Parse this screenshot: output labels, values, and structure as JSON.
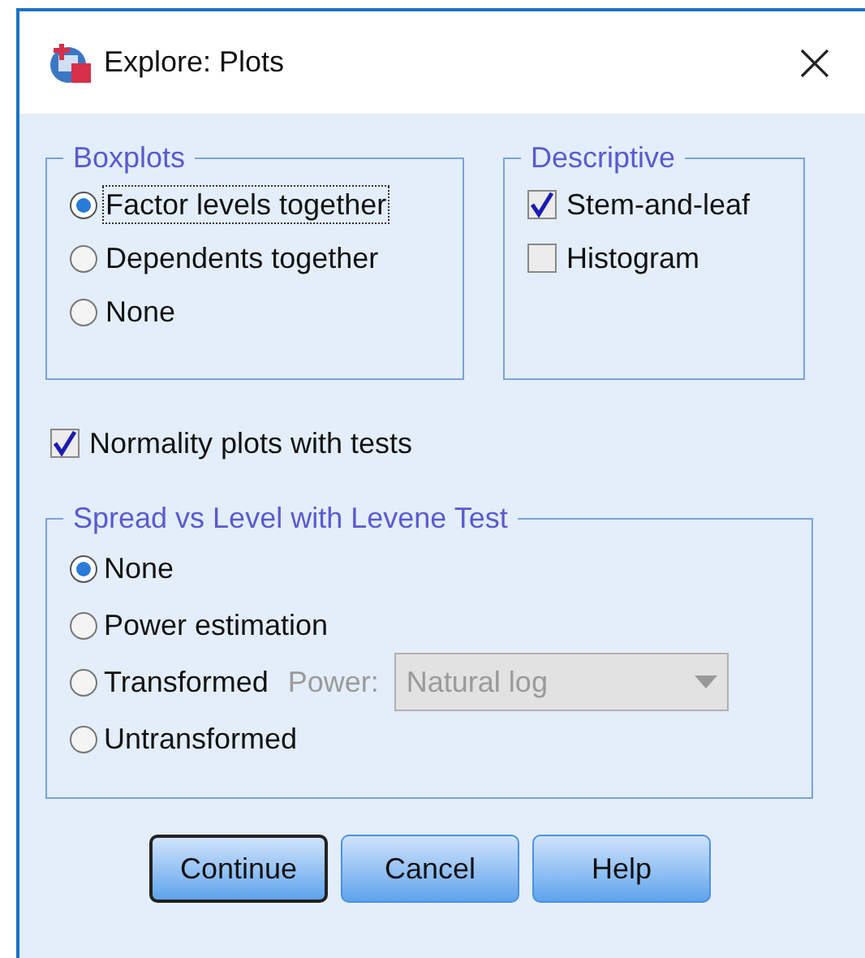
{
  "window": {
    "title": "Explore: Plots"
  },
  "boxplots": {
    "title": "Boxplots",
    "options": [
      {
        "label": "Factor levels together",
        "selected": true,
        "focused": true
      },
      {
        "label": "Dependents together",
        "selected": false,
        "focused": false
      },
      {
        "label": "None",
        "selected": false,
        "focused": false
      }
    ]
  },
  "descriptive": {
    "title": "Descriptive",
    "options": [
      {
        "label": "Stem-and-leaf",
        "checked": true
      },
      {
        "label": "Histogram",
        "checked": false
      }
    ]
  },
  "normality": {
    "label": "Normality plots with tests",
    "checked": true
  },
  "spread": {
    "title": "Spread vs Level with Levene Test",
    "options": [
      {
        "label": "None",
        "selected": true
      },
      {
        "label": "Power estimation",
        "selected": false
      },
      {
        "label": "Transformed",
        "selected": false,
        "power": {
          "label": "Power:",
          "value": "Natural log",
          "disabled": true
        }
      },
      {
        "label": "Untransformed",
        "selected": false
      }
    ]
  },
  "buttons": [
    {
      "label": "Continue",
      "default": true
    },
    {
      "label": "Cancel",
      "default": false
    },
    {
      "label": "Help",
      "default": false
    }
  ]
}
